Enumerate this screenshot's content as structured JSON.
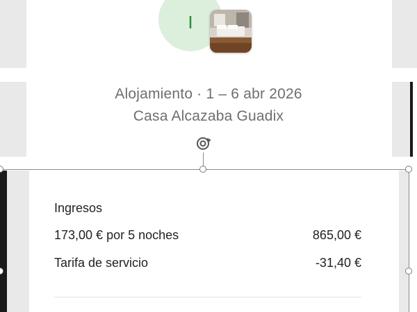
{
  "host": {
    "initial": "I"
  },
  "booking": {
    "summary": "Alojamiento · 1 – 6 abr 2026",
    "listing_name": "Casa Alcazaba Guadix"
  },
  "earnings": {
    "title": "Ingresos",
    "rows": [
      {
        "label": "173,00 € por 5 noches",
        "amount": "865,00 €"
      },
      {
        "label": "Tarifa de servicio",
        "amount": "-31,40 €"
      }
    ]
  },
  "colors": {
    "avatar_bg": "#dcefdc",
    "avatar_text": "#2e8b3a",
    "muted_text": "#6e6e6e",
    "body_text": "#222222"
  },
  "icons": {
    "rotate": "rotate-icon"
  }
}
